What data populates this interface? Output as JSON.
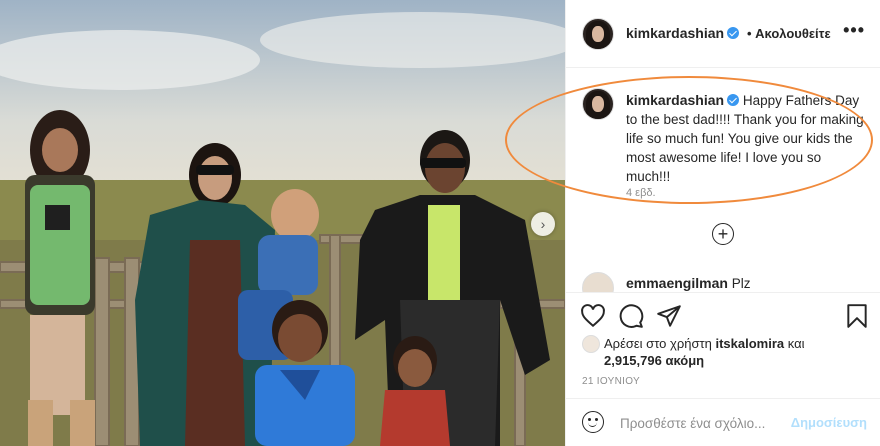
{
  "post": {
    "author": "kimkardashian",
    "follow_label": "• Ακολουθείτε",
    "more_icon": "•••"
  },
  "caption": {
    "username": "kimkardashian",
    "text": "Happy Fathers Day to the best dad!!!! Thank you for making life so much fun! You give our kids the most awesome life! I love you so much!!!",
    "time": "4 εβδ."
  },
  "comments": {
    "load_more_icon": "+",
    "peek_username": "emmaengilman",
    "peek_text": "Plz"
  },
  "likes": {
    "prefix": "Αρέσει στο χρήστη",
    "user": "itskalomira",
    "connector": "και",
    "count": "2,915,796",
    "suffix": "ακόμη"
  },
  "date": "21 ΙΟΥΝΙΟΥ",
  "comment_box": {
    "placeholder": "Προσθέστε ένα σχόλιο...",
    "post_label": "Δημοσίευση"
  },
  "carousel": {
    "next_icon": "›"
  },
  "colors": {
    "verified": "#3897f0",
    "highlight": "#f08a3c",
    "post_disabled": "#b2dffc"
  },
  "icons": [
    "heart-icon",
    "comment-icon",
    "share-icon",
    "bookmark-icon",
    "emoji-icon",
    "plus-circle-icon",
    "verified-icon",
    "more-icon",
    "chevron-right-icon"
  ]
}
